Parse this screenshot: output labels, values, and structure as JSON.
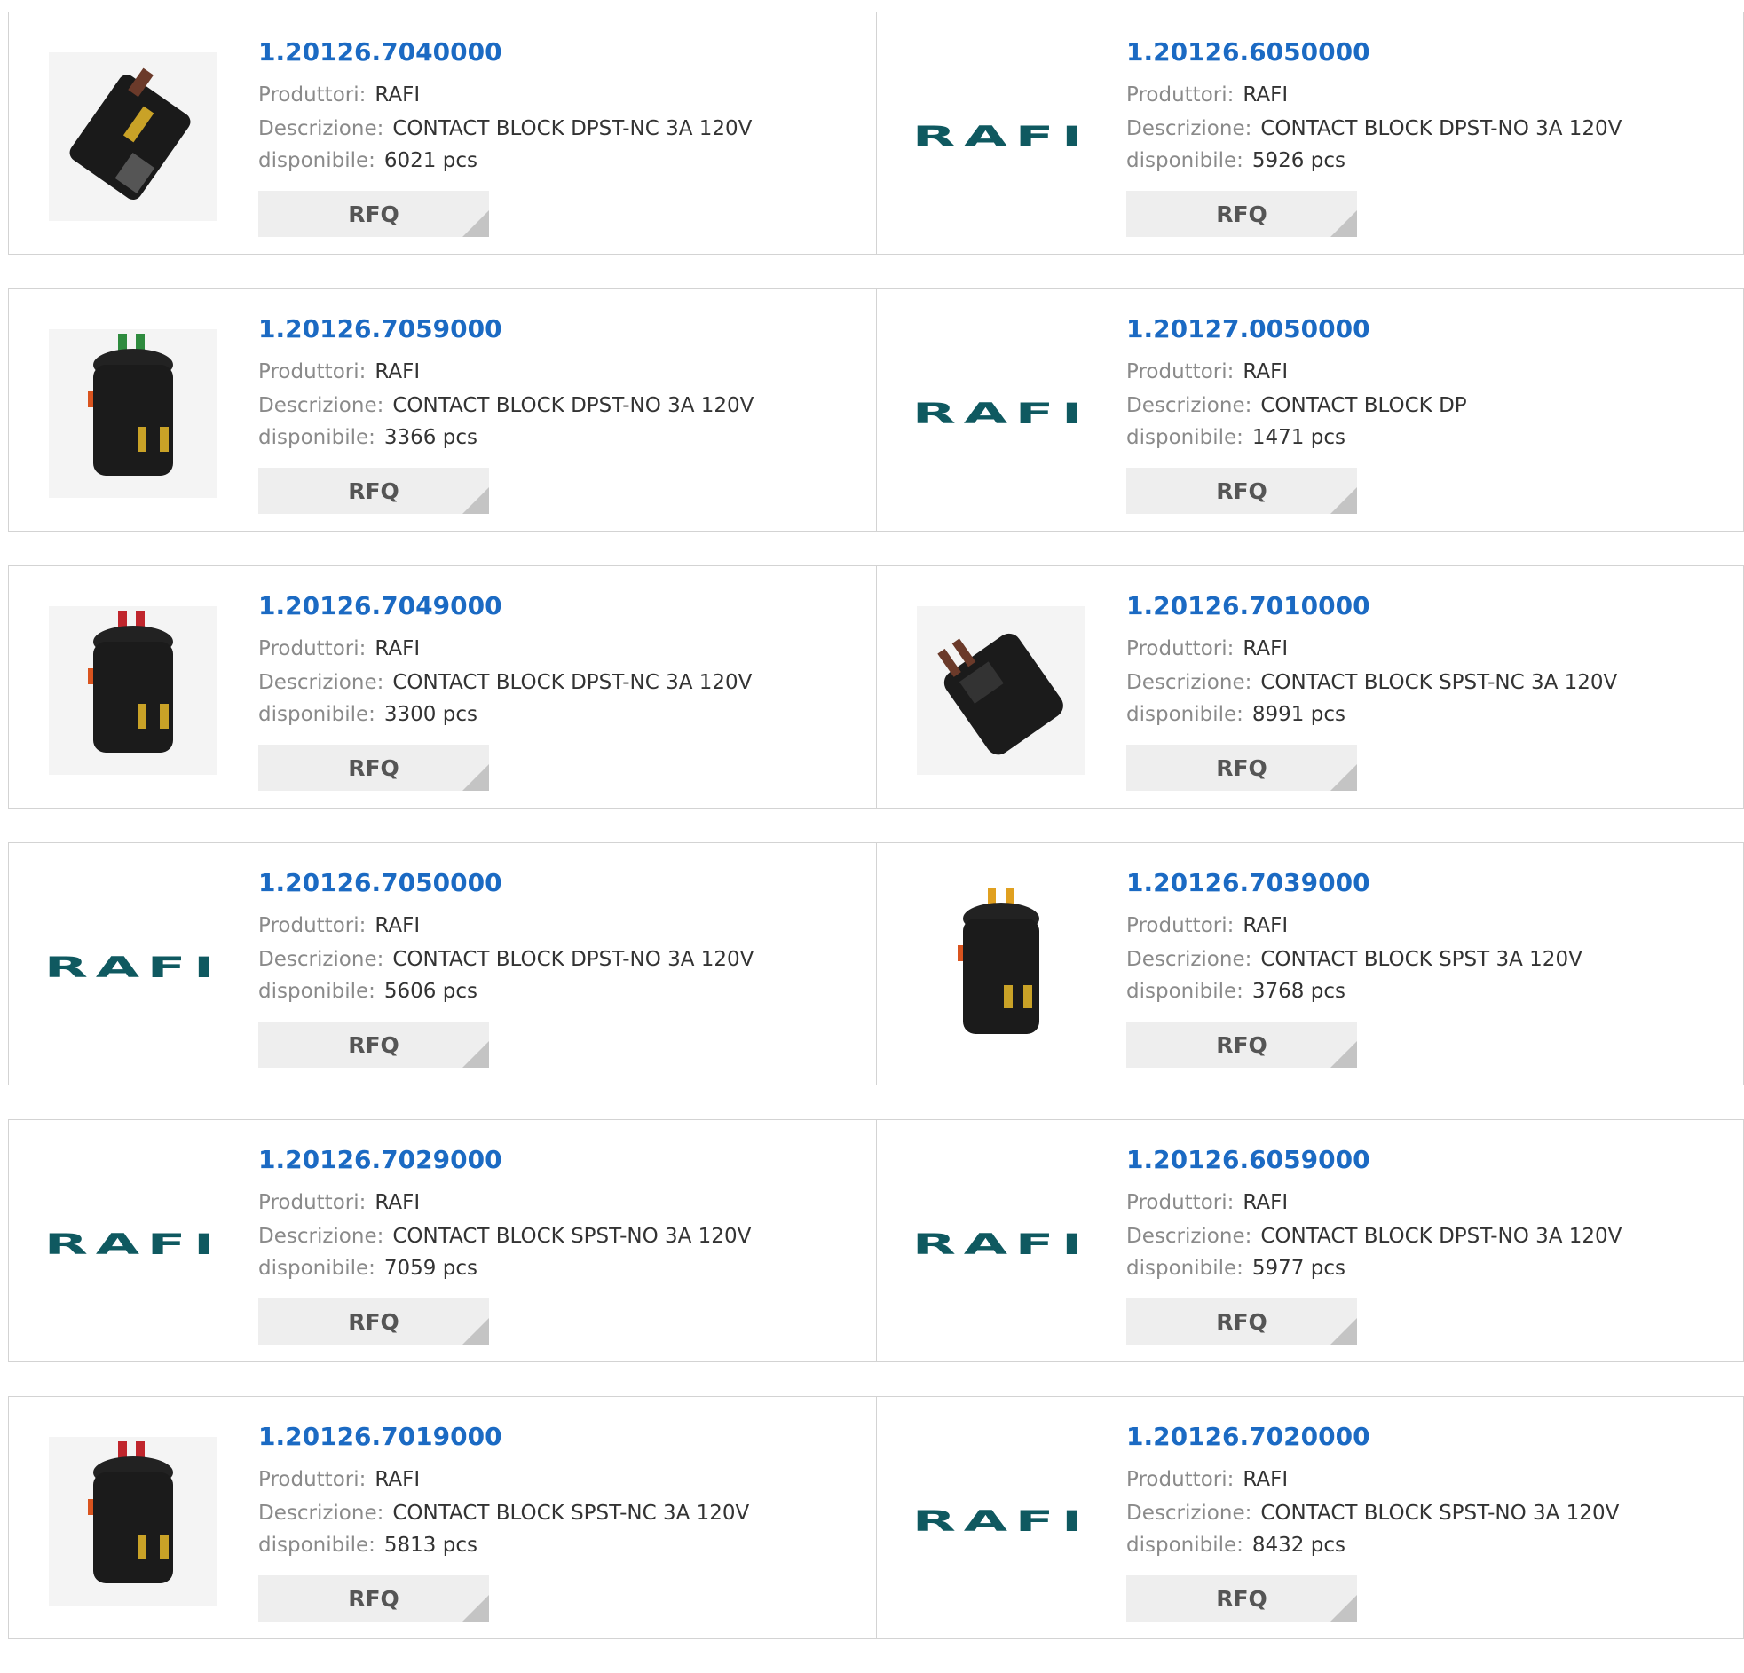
{
  "labels": {
    "manufacturer": "Produttori:",
    "description": "Descrizione:",
    "available": "disponibile:",
    "rfq": "RFQ"
  },
  "brand_logo_text": "RAFI",
  "products": [
    {
      "part_number": "1.20126.7040000",
      "manufacturer": "RAFI",
      "description": "CONTACT BLOCK DPST-NC 3A 120V",
      "stock": "6021 pcs",
      "image": "contact-block-side-photo"
    },
    {
      "part_number": "1.20126.6050000",
      "manufacturer": "RAFI",
      "description": "CONTACT BLOCK DPST-NO 3A 120V",
      "stock": "5926 pcs",
      "image": "rafi-logo"
    },
    {
      "part_number": "1.20126.7059000",
      "manufacturer": "RAFI",
      "description": "CONTACT BLOCK DPST-NO 3A 120V",
      "stock": "3366 pcs",
      "image": "contact-block-green-photo"
    },
    {
      "part_number": "1.20127.0050000",
      "manufacturer": "RAFI",
      "description": "CONTACT BLOCK DP",
      "stock": "1471 pcs",
      "image": "rafi-logo"
    },
    {
      "part_number": "1.20126.7049000",
      "manufacturer": "RAFI",
      "description": "CONTACT BLOCK DPST-NC 3A 120V",
      "stock": "3300 pcs",
      "image": "contact-block-red-photo"
    },
    {
      "part_number": "1.20126.7010000",
      "manufacturer": "RAFI",
      "description": "CONTACT BLOCK SPST-NC 3A 120V",
      "stock": "8991 pcs",
      "image": "contact-block-angled-photo"
    },
    {
      "part_number": "1.20126.7050000",
      "manufacturer": "RAFI",
      "description": "CONTACT BLOCK DPST-NO 3A 120V",
      "stock": "5606 pcs",
      "image": "rafi-logo"
    },
    {
      "part_number": "1.20126.7039000",
      "manufacturer": "RAFI",
      "description": "CONTACT BLOCK SPST 3A 120V",
      "stock": "3768 pcs",
      "image": "contact-block-orange-photo"
    },
    {
      "part_number": "1.20126.7029000",
      "manufacturer": "RAFI",
      "description": "CONTACT BLOCK SPST-NO 3A 120V",
      "stock": "7059 pcs",
      "image": "rafi-logo"
    },
    {
      "part_number": "1.20126.6059000",
      "manufacturer": "RAFI",
      "description": "CONTACT BLOCK DPST-NO 3A 120V",
      "stock": "5977 pcs",
      "image": "rafi-logo"
    },
    {
      "part_number": "1.20126.7019000",
      "manufacturer": "RAFI",
      "description": "CONTACT BLOCK SPST-NC 3A 120V",
      "stock": "5813 pcs",
      "image": "contact-block-red-photo"
    },
    {
      "part_number": "1.20126.7020000",
      "manufacturer": "RAFI",
      "description": "CONTACT BLOCK SPST-NO 3A 120V",
      "stock": "8432 pcs",
      "image": "rafi-logo"
    }
  ],
  "colors": {
    "part_number_link": "#1b6ac3",
    "label_gray": "#8a8a8a",
    "value_text": "#333333",
    "rafi_logo": "#0f5960",
    "rfq_background": "#eeeeee",
    "border": "#d3d3d3"
  }
}
